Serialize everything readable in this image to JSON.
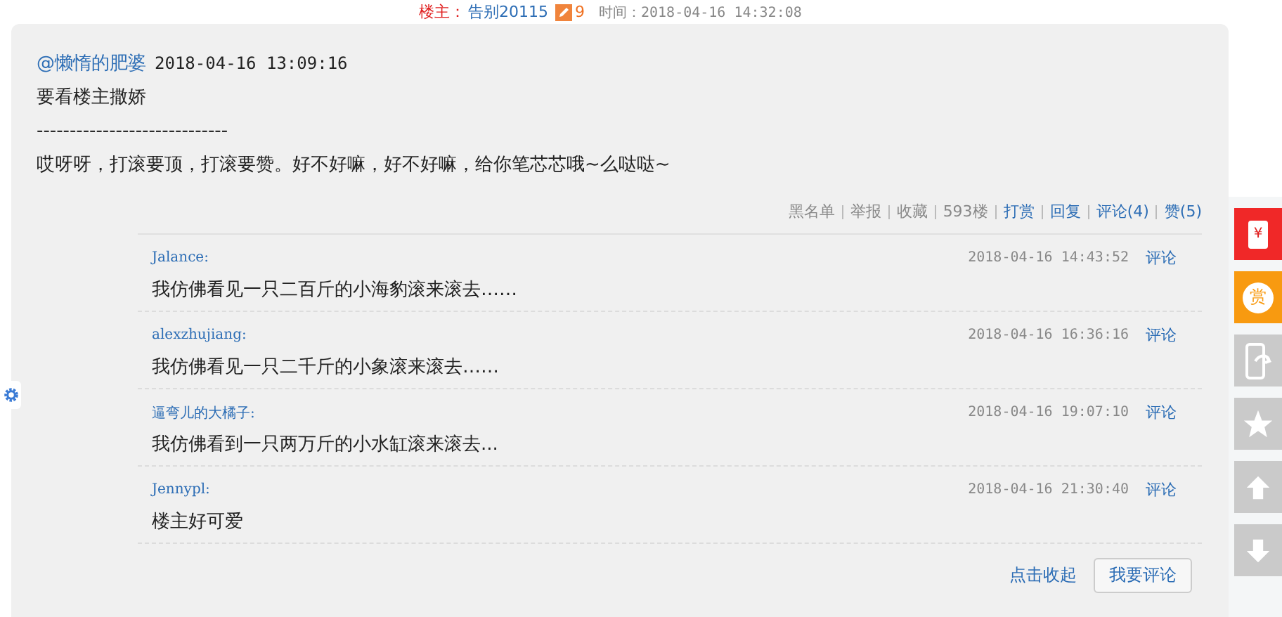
{
  "header": {
    "owner_label": "楼主：",
    "owner_name": "告别20115",
    "owner_count": "9",
    "time": "时间：2018-04-16 14:32:08"
  },
  "post": {
    "author": "@懒惰的肥婆",
    "date": "2018-04-16 13:09:16",
    "lines": [
      "要看楼主撒娇",
      "-----------------------------",
      "哎呀呀，打滚要顶，打滚要赞。好不好嘛，好不好嘛，给你笔芯芯哦~么哒哒~"
    ]
  },
  "actions": [
    {
      "label": "黑名单",
      "kind": "plain"
    },
    {
      "label": "举报",
      "kind": "plain"
    },
    {
      "label": "收藏",
      "kind": "plain"
    },
    {
      "label": "593楼",
      "kind": "plain"
    },
    {
      "label": "打赏",
      "kind": "strong"
    },
    {
      "label": "回复",
      "kind": "strong"
    },
    {
      "label": "评论(4)",
      "kind": "link"
    },
    {
      "label": "赞(5)",
      "kind": "link"
    }
  ],
  "comments": [
    {
      "user": "Jalance:",
      "text": "我仿佛看见一只二百斤的小海豹滚来滚去……",
      "date": "2018-04-16 14:43:52",
      "action": "评论"
    },
    {
      "user": "alexzhujiang:",
      "text": "我仿佛看见一只二千斤的小象滚来滚去……",
      "date": "2018-04-16 16:36:16",
      "action": "评论"
    },
    {
      "user": "逼弯儿的大橘子:",
      "text": "我仿佛看到一只两万斤的小水缸滚来滚去...",
      "date": "2018-04-16 19:07:10",
      "action": "评论"
    },
    {
      "user": "Jennypl:",
      "text": "楼主好可爱",
      "date": "2018-04-16 21:30:40",
      "action": "评论"
    }
  ],
  "footer": {
    "collapse": "点击收起",
    "comment_button": "我要评论"
  },
  "side_tools": [
    {
      "kind": "redpacket",
      "glyph": "¥"
    },
    {
      "kind": "reward",
      "glyph": "赏"
    },
    {
      "kind": "phone"
    },
    {
      "kind": "star"
    },
    {
      "kind": "up"
    },
    {
      "kind": "down"
    }
  ]
}
